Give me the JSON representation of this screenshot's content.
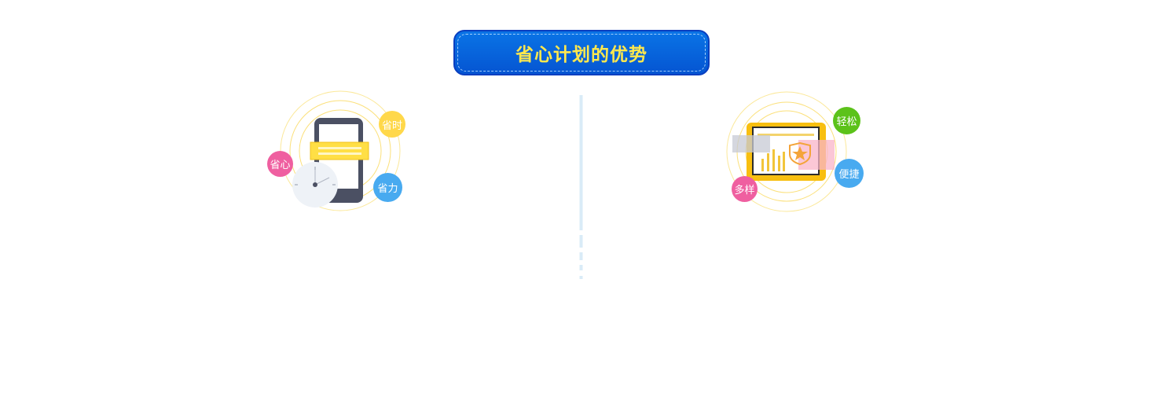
{
  "header": {
    "title": "省心计划的优势"
  },
  "left_feature": {
    "badges": {
      "top_right": "省时",
      "left": "省心",
      "bottom_right": "省力"
    },
    "colors": {
      "time": "#ffd84a",
      "mind": "#ef5fa0",
      "effort": "#48aaf0"
    }
  },
  "right_feature": {
    "badges": {
      "top_right": "轻松",
      "right": "便捷",
      "bottom_left": "多样"
    },
    "colors": {
      "easy": "#5cc21a",
      "convenient": "#48aaf0",
      "varied": "#ef5fa0"
    }
  }
}
